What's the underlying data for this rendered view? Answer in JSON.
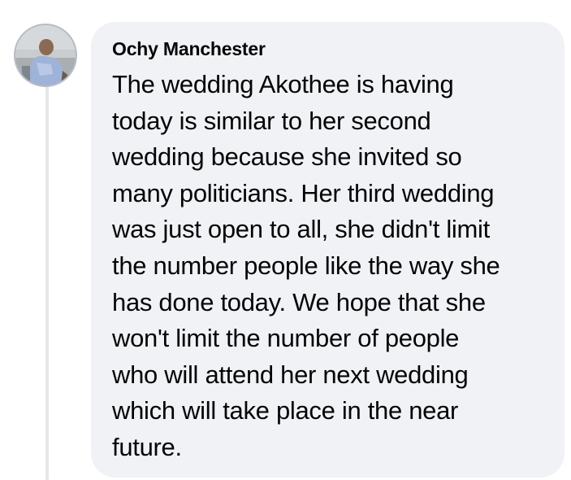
{
  "comment": {
    "author": "Ochy Manchester",
    "avatar_icon": "profile-photo",
    "lines": [
      "The wedding Akothee is having",
      "today is similar to her second",
      "wedding because she invited so",
      "many politicians. Her third wedding",
      "was just open to all, she didn't limit",
      "the number people like the way she",
      "has done today. We hope that she",
      "won't limit the number of people",
      "who will attend her next wedding",
      "which will take place in the near",
      "future."
    ]
  },
  "colors": {
    "bubble": "#f0f2f5",
    "text": "#050505",
    "thread_line": "#e4e6eb"
  }
}
